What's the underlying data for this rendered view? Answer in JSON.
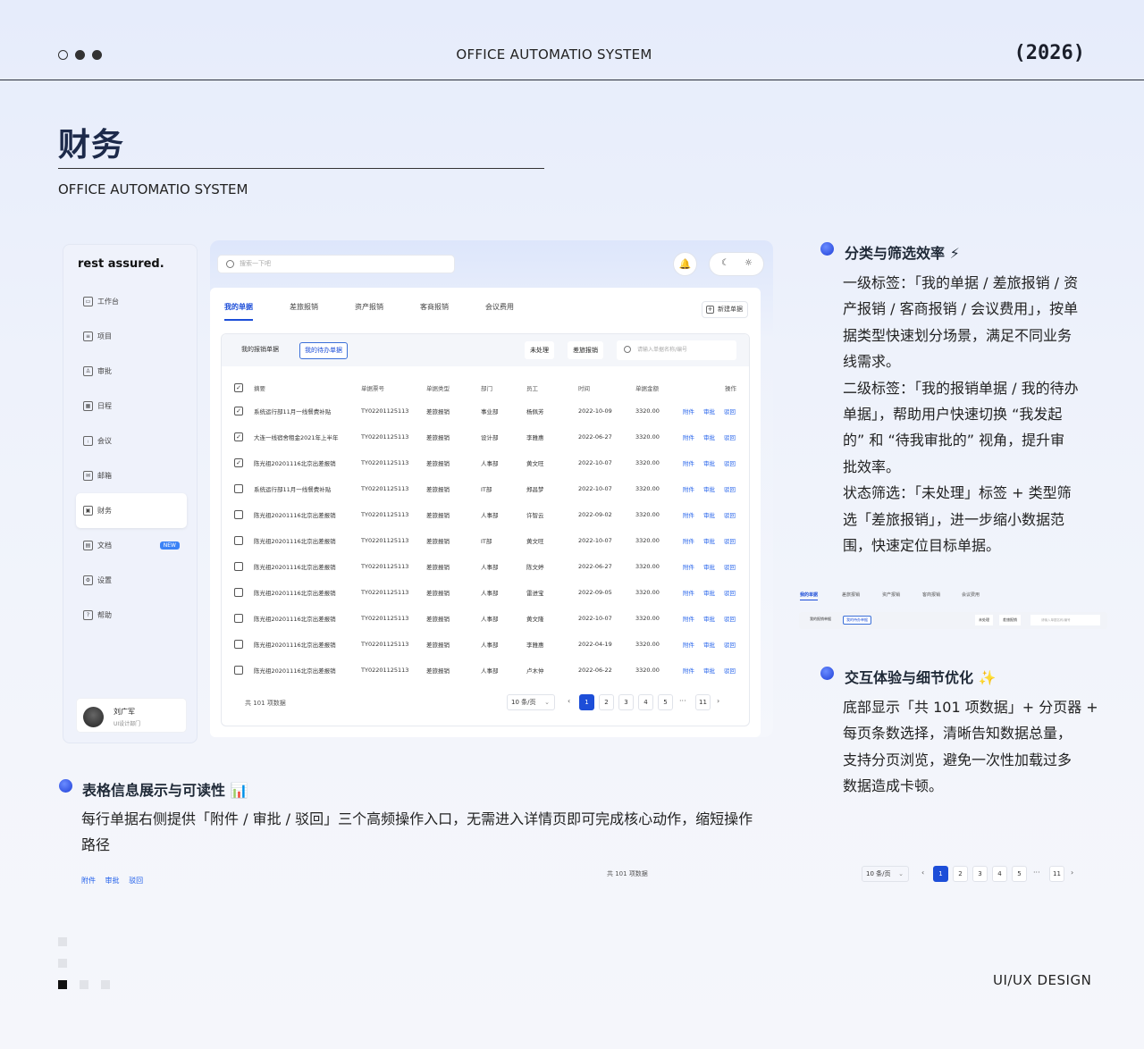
{
  "header": {
    "title": "OFFICE AUTOMATIO SYSTEM",
    "year": "(2026)"
  },
  "page": {
    "title": "财务",
    "subtitle": "OFFICE AUTOMATIO SYSTEM"
  },
  "app": {
    "brand": "rest assured.",
    "nav": [
      {
        "label": "工作台",
        "icon": "dashboard-icon"
      },
      {
        "label": "项目",
        "icon": "project-icon"
      },
      {
        "label": "审批",
        "icon": "approval-icon"
      },
      {
        "label": "日程",
        "icon": "calendar-icon"
      },
      {
        "label": "会议",
        "icon": "meeting-icon"
      },
      {
        "label": "邮箱",
        "icon": "mail-icon"
      },
      {
        "label": "财务",
        "icon": "finance-icon",
        "active": true
      },
      {
        "label": "文档",
        "icon": "document-icon",
        "badge": "NEW"
      },
      {
        "label": "设置",
        "icon": "settings-icon"
      },
      {
        "label": "帮助",
        "icon": "help-icon"
      }
    ],
    "user": {
      "name": "刘广军",
      "role": "UI设计部门"
    },
    "search_placeholder": "搜索一下吧",
    "tabs": [
      "我的单据",
      "差旅报销",
      "资产报销",
      "客商报销",
      "会议费用"
    ],
    "new_button": "新建单据",
    "subtabs": [
      "我的报销单据",
      "我的待办单据"
    ],
    "chips": [
      "未处理",
      "差旅报销"
    ],
    "filter_placeholder": "请输入单据名称/编号",
    "columns": [
      "摘要",
      "单据票号",
      "单据类型",
      "部门",
      "员工",
      "时间",
      "单据金额",
      "操作"
    ],
    "rows": [
      {
        "checked": true,
        "summary": "系统运行部11月一线餐费补贴",
        "no": "TY02201125113",
        "type": "差旅报销",
        "dept": "事业部",
        "emp": "杨佩芳",
        "date": "2022-10-09",
        "amount": "3320.00"
      },
      {
        "checked": true,
        "summary": "大连一线宿舍租金2021年上半年",
        "no": "TY02201125113",
        "type": "差旅报销",
        "dept": "设计部",
        "emp": "李雅惠",
        "date": "2022-06-27",
        "amount": "3320.00"
      },
      {
        "checked": true,
        "summary": "陈光祖20201116北京出差报销",
        "no": "TY02201125113",
        "type": "差旅报销",
        "dept": "人事部",
        "emp": "黄文旺",
        "date": "2022-10-07",
        "amount": "3320.00"
      },
      {
        "checked": false,
        "summary": "系统运行部11月一线餐费补贴",
        "no": "TY02201125113",
        "type": "差旅报销",
        "dept": "IT部",
        "emp": "郑昌梦",
        "date": "2022-10-07",
        "amount": "3320.00"
      },
      {
        "checked": false,
        "summary": "陈光祖20201116北京出差报销",
        "no": "TY02201125113",
        "type": "差旅报销",
        "dept": "人事部",
        "emp": "许智云",
        "date": "2022-09-02",
        "amount": "3320.00"
      },
      {
        "checked": false,
        "summary": "陈光祖20201116北京出差报销",
        "no": "TY02201125113",
        "type": "差旅报销",
        "dept": "IT部",
        "emp": "黄文旺",
        "date": "2022-10-07",
        "amount": "3320.00"
      },
      {
        "checked": false,
        "summary": "陈光祖20201116北京出差报销",
        "no": "TY02201125113",
        "type": "差旅报销",
        "dept": "人事部",
        "emp": "陈文婷",
        "date": "2022-06-27",
        "amount": "3320.00"
      },
      {
        "checked": false,
        "summary": "陈光祖20201116北京出差报销",
        "no": "TY02201125113",
        "type": "差旅报销",
        "dept": "人事部",
        "emp": "雷进宝",
        "date": "2022-09-05",
        "amount": "3320.00"
      },
      {
        "checked": false,
        "summary": "陈光祖20201116北京出差报销",
        "no": "TY02201125113",
        "type": "差旅报销",
        "dept": "人事部",
        "emp": "黄文隆",
        "date": "2022-10-07",
        "amount": "3320.00"
      },
      {
        "checked": false,
        "summary": "陈光祖20201116北京出差报销",
        "no": "TY02201125113",
        "type": "差旅报销",
        "dept": "人事部",
        "emp": "李雅惠",
        "date": "2022-04-19",
        "amount": "3320.00"
      },
      {
        "checked": false,
        "summary": "陈光祖20201116北京出差报销",
        "no": "TY02201125113",
        "type": "差旅报销",
        "dept": "人事部",
        "emp": "卢木仲",
        "date": "2022-06-22",
        "amount": "3320.00"
      }
    ],
    "actions": [
      "附件",
      "审批",
      "驳回"
    ],
    "total": "共 101 项数据",
    "page_size": "10 条/页",
    "pages": [
      "1",
      "2",
      "3",
      "4",
      "5",
      "···",
      "11"
    ],
    "current_page": "1"
  },
  "notes": {
    "filter": {
      "title": "分类与筛选效率 ⚡",
      "lines": [
        "一级标签：「我的单据 / 差旅报销 / 资",
        "产报销 / 客商报销 / 会议费用」，按单",
        "据类型快速划分场景，满足不同业务",
        "线需求。",
        "二级标签：「我的报销单据 / 我的待办",
        "单据」，帮助用户快速切换 “我发起",
        "的” 和 “待我审批的” 视角，提升审",
        "批效率。",
        "状态筛选：「未处理」标签 + 类型筛",
        "选「差旅报销」，进一步缩小数据范",
        "围，快速定位目标单据。"
      ]
    },
    "interaction": {
      "title": "交互体验与细节优化 ✨",
      "lines": [
        "底部显示「共 101 项数据」+ 分页器 +",
        "每页条数选择，清晰告知数据总量，",
        "支持分页浏览，避免一次性加载过多",
        "数据造成卡顿。"
      ]
    },
    "table": {
      "title": "表格信息展示与可读性 📊",
      "lines": [
        "每行单据右侧提供「附件 / 审批 / 驳回」三个高频操作入口，无需进入详情页即可完成核心动作，缩短操作",
        "路径"
      ]
    }
  },
  "footer": {
    "label": "UI/UX DESIGN"
  }
}
